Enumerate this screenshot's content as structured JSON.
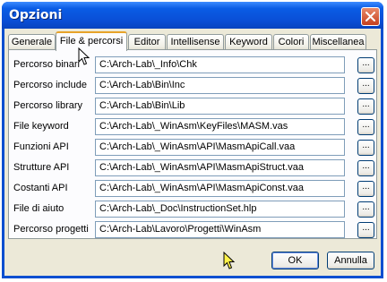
{
  "window": {
    "title": "Opzioni",
    "accent": "#0a4fd0",
    "close_icon": "close-icon"
  },
  "tabs": [
    {
      "label": "Generale"
    },
    {
      "label": "File & percorsi"
    },
    {
      "label": "Editor"
    },
    {
      "label": "Intellisense"
    },
    {
      "label": "Keyword"
    },
    {
      "label": "Colori"
    },
    {
      "label": "Miscellanea"
    }
  ],
  "active_tab": "File & percorsi",
  "rows": [
    {
      "label": "Percorso binari",
      "value": "C:\\Arch-Lab\\_Info\\Chk",
      "button": "..."
    },
    {
      "label": "Percorso include",
      "value": "C:\\Arch-Lab\\Bin\\Inc",
      "button": "..."
    },
    {
      "label": "Percorso library",
      "value": "C:\\Arch-Lab\\Bin\\Lib",
      "button": "..."
    },
    {
      "label": "File keyword",
      "value": "C:\\Arch-Lab\\_WinAsm\\KeyFiles\\MASM.vas",
      "button": "..."
    },
    {
      "label": "Funzioni API",
      "value": "C:\\Arch-Lab\\_WinAsm\\API\\MasmApiCall.vaa",
      "button": "..."
    },
    {
      "label": "Strutture API",
      "value": "C:\\Arch-Lab\\_WinAsm\\API\\MasmApiStruct.vaa",
      "button": "..."
    },
    {
      "label": "Costanti API",
      "value": "C:\\Arch-Lab\\_WinAsm\\API\\MasmApiConst.vaa",
      "button": "..."
    },
    {
      "label": "File di aiuto",
      "value": "C:\\Arch-Lab\\_Doc\\InstructionSet.hlp",
      "button": "..."
    },
    {
      "label": "Percorso progetti",
      "value": "C:\\Arch-Lab\\Lavoro\\Progetti\\WinAsm",
      "button": "..."
    }
  ],
  "buttons": {
    "ok": "OK",
    "cancel": "Annulla"
  }
}
